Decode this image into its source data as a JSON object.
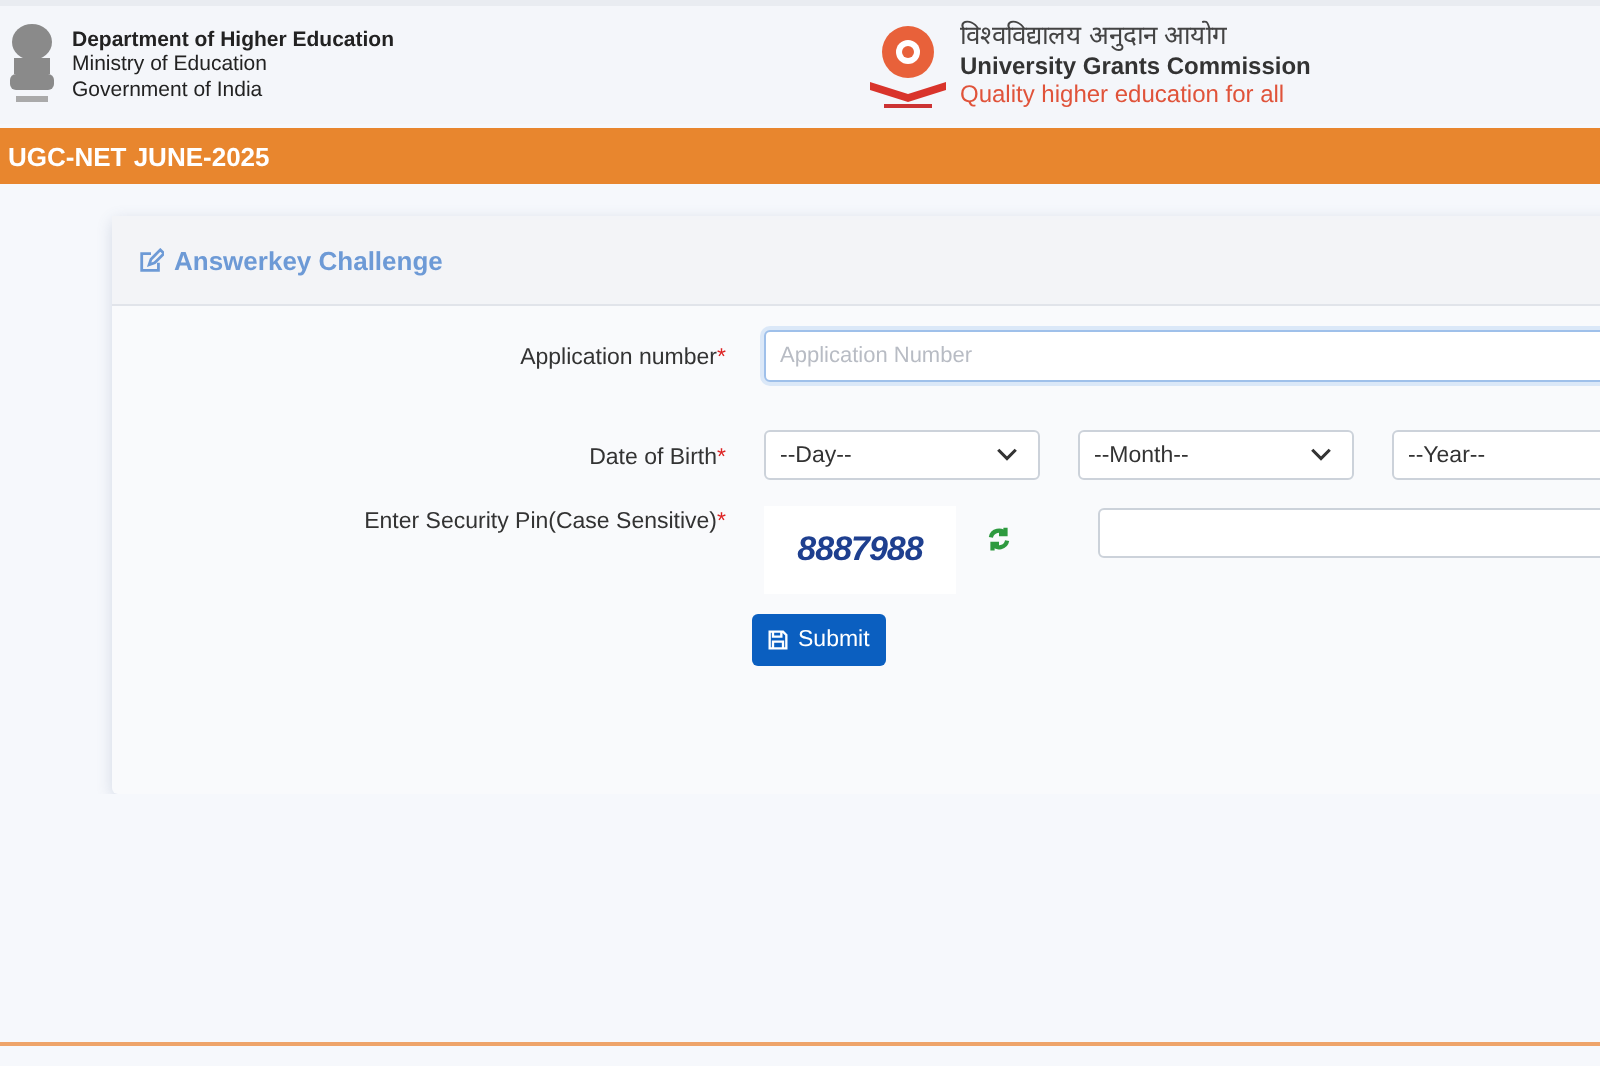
{
  "header": {
    "department": "Department of Higher Education",
    "ministry": "Ministry of Education",
    "government": "Government of India",
    "ugc_hindi": "विश्वविद्यालय अनुदान आयोग",
    "ugc_name": "University Grants Commission",
    "ugc_tagline": "Quality higher education for all"
  },
  "banner": {
    "title": "UGC-NET JUNE-2025"
  },
  "card": {
    "title": "Answerkey Challenge",
    "fields": [
      {
        "kind": "text",
        "label": "Application number",
        "required_mark": "*",
        "placeholder": "Application Number",
        "focused": true
      },
      {
        "kind": "date",
        "label": "Date of Birth",
        "required_mark": "*",
        "selects": [
          "--Day--",
          "--Month--",
          "--Year--"
        ]
      },
      {
        "kind": "captcha",
        "label": "Enter Security Pin(Case Sensitive)",
        "required_mark": "*",
        "captcha": "8887988"
      }
    ],
    "submit": "Submit"
  }
}
